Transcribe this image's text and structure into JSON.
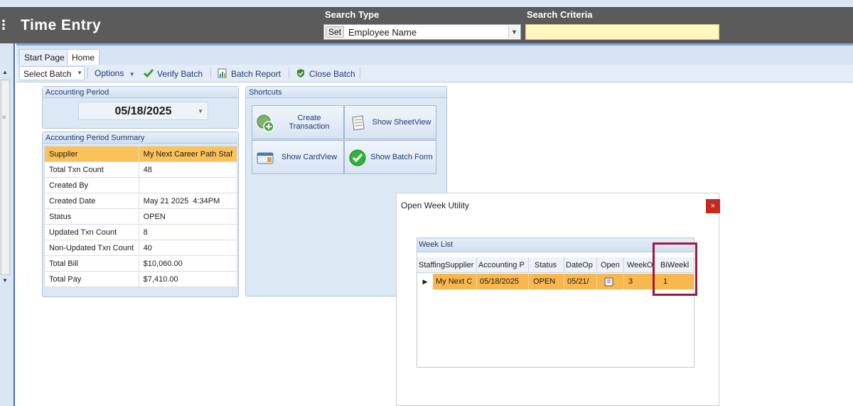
{
  "header": {
    "app_title": "Time Entry",
    "search_type_label": "Search Type",
    "search_criteria_label": "Search Criteria",
    "set_label": "Set",
    "search_type_value": "Employee Name",
    "search_criteria_value": ""
  },
  "tabs": [
    {
      "label": "Start Page"
    },
    {
      "label": "Home"
    }
  ],
  "toolbar": {
    "select_batch": "Select Batch",
    "options": "Options",
    "verify_batch": "Verify Batch",
    "batch_report": "Batch Report",
    "close_batch": "Close Batch"
  },
  "accounting_period": {
    "title": "Accounting Period",
    "date": "05/18/2025"
  },
  "summary": {
    "title": "Accounting Period Summary",
    "rows": [
      {
        "key": "Supplier",
        "value": "My Next Career Path Staf"
      },
      {
        "key": "Total Txn Count",
        "value": "48"
      },
      {
        "key": "Created By",
        "value": ""
      },
      {
        "key": "Created Date",
        "value": "May 21 2025  4:34PM"
      },
      {
        "key": "Status",
        "value": "OPEN"
      },
      {
        "key": "Updated Txn Count",
        "value": "8"
      },
      {
        "key": "Non-Updated Txn Count",
        "value": "40"
      },
      {
        "key": "Total Bill",
        "value": "$10,060.00"
      },
      {
        "key": "Total Pay",
        "value": "$7,410.00"
      }
    ]
  },
  "shortcuts": {
    "title": "Shortcuts",
    "create_transaction": "Create Transaction",
    "show_sheetview": "Show SheetView",
    "show_cardview": "Show CardView",
    "show_batch_form": "Show Batch Form"
  },
  "dialog": {
    "title": "Open Week Utility",
    "close_glyph": "×",
    "week_list_title": "Week List",
    "columns": [
      "StaffingSupplier",
      "Accounting P",
      "Status",
      "DateOp",
      "Open",
      "WeekO",
      "BiWeekl"
    ],
    "row": {
      "supplier": "My Next C",
      "accounting_period": "05/18/2025",
      "status": "OPEN",
      "date_opened": "05/21/",
      "week_of": "3",
      "biweekly": "1"
    }
  },
  "colors": {
    "title_bar": "#5b5b5b",
    "highlight_row": "#f9b84f",
    "annotation_box": "#9b1b3d",
    "close_button": "#c42b1c"
  }
}
